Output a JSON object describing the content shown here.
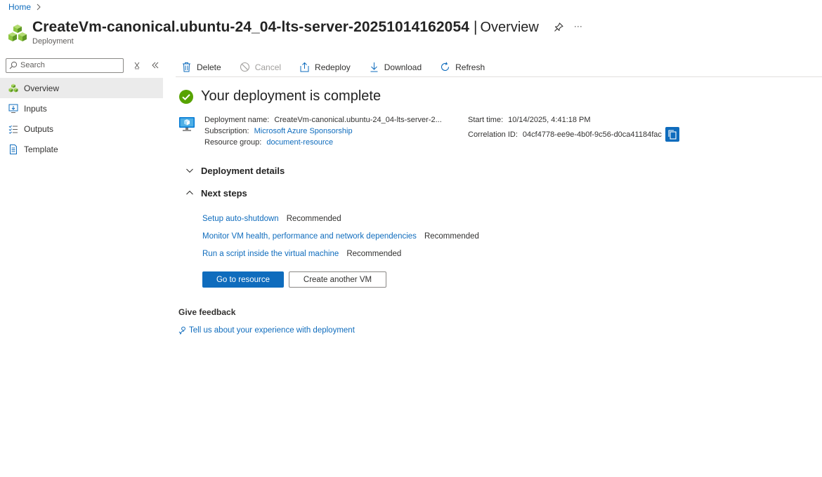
{
  "breadcrumb": {
    "home": "Home"
  },
  "header": {
    "title": "CreateVm-canonical.ubuntu-24_04-lts-server-20251014162054",
    "separator": "|",
    "section": "Overview",
    "subtitle": "Deployment",
    "more": "···"
  },
  "leftnav": {
    "search_placeholder": "Search",
    "items": [
      {
        "label": "Overview",
        "icon": "deployment-cubes-icon",
        "active": true
      },
      {
        "label": "Inputs",
        "icon": "inputs-icon"
      },
      {
        "label": "Outputs",
        "icon": "outputs-list-icon"
      },
      {
        "label": "Template",
        "icon": "template-doc-icon"
      }
    ]
  },
  "toolbar": {
    "delete": "Delete",
    "cancel": "Cancel",
    "redeploy": "Redeploy",
    "download": "Download",
    "refresh": "Refresh"
  },
  "main": {
    "status_title": "Your deployment is complete",
    "deployment_name_label": "Deployment name:",
    "deployment_name": "CreateVm-canonical.ubuntu-24_04-lts-server-2...",
    "subscription_label": "Subscription:",
    "subscription": "Microsoft Azure Sponsorship",
    "resource_group_label": "Resource group:",
    "resource_group": "document-resource",
    "start_time_label": "Start time:",
    "start_time": "10/14/2025, 4:41:18 PM",
    "correlation_label": "Correlation ID:",
    "correlation_id": "04cf4778-ee9e-4b0f-9c56-d0ca41184fac",
    "deployment_details": "Deployment details",
    "next_steps": "Next steps",
    "steps": [
      {
        "link": "Setup auto-shutdown",
        "tag": "Recommended"
      },
      {
        "link": "Monitor VM health, performance and network dependencies",
        "tag": "Recommended"
      },
      {
        "link": "Run a script inside the virtual machine",
        "tag": "Recommended"
      }
    ],
    "go_to_resource": "Go to resource",
    "create_another": "Create another VM",
    "feedback_title": "Give feedback",
    "feedback_link": "Tell us about your experience with deployment"
  },
  "colors": {
    "accent": "#0f6cbd",
    "success": "#57a300",
    "resource_green": "#8dc63f"
  }
}
